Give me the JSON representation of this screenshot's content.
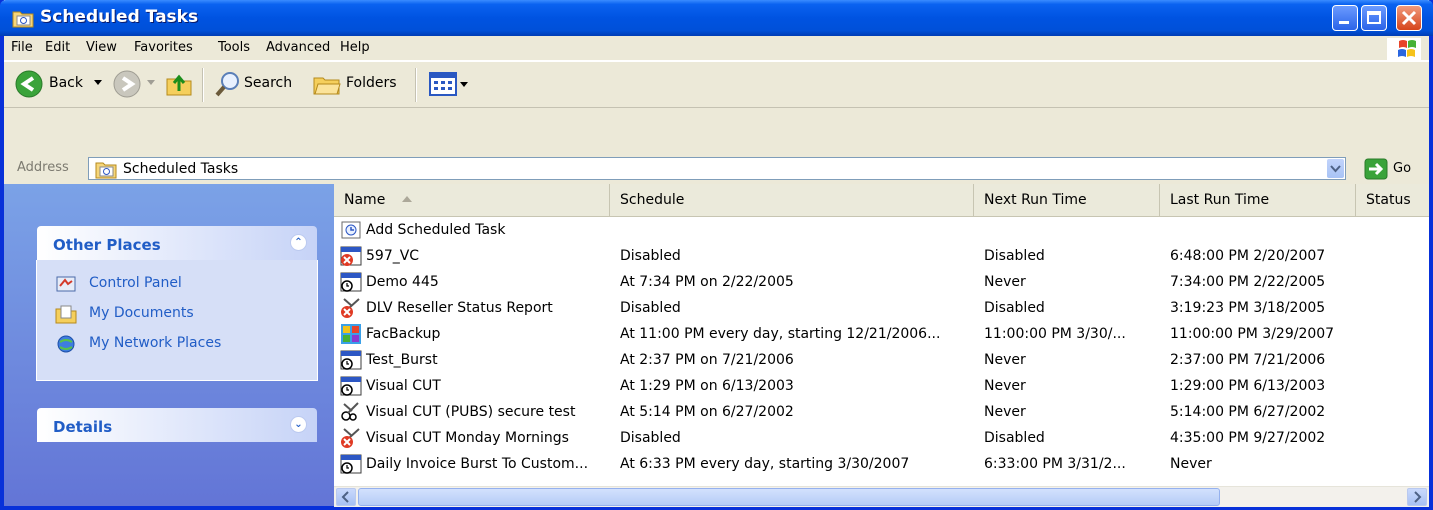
{
  "window": {
    "title": "Scheduled Tasks"
  },
  "menu": [
    {
      "label": "File",
      "ul": "F"
    },
    {
      "label": "Edit",
      "ul": "E"
    },
    {
      "label": "View",
      "ul": "V"
    },
    {
      "label": "Favorites",
      "ul": "a"
    },
    {
      "label": "Tools",
      "ul": "T"
    },
    {
      "label": "Advanced",
      "ul": "d"
    },
    {
      "label": "Help",
      "ul": "H"
    }
  ],
  "toolbar": {
    "back": "Back",
    "search": "Search",
    "folders": "Folders"
  },
  "address": {
    "label": "Address",
    "value": "Scheduled Tasks",
    "go": "Go"
  },
  "other_places": {
    "title": "Other Places",
    "items": [
      "Control Panel",
      "My Documents",
      "My Network Places"
    ]
  },
  "details": {
    "title": "Details"
  },
  "columns": [
    "Name",
    "Schedule",
    "Next Run Time",
    "Last Run Time",
    "Status"
  ],
  "rows": [
    {
      "name": "Add Scheduled Task",
      "schedule": "",
      "next": "",
      "last": "",
      "icon": "add-task-icon"
    },
    {
      "name": "597_VC",
      "schedule": "Disabled",
      "next": "Disabled",
      "last": "6:48:00 PM  2/20/2007",
      "icon": "disabled-task-icon"
    },
    {
      "name": "Demo 445",
      "schedule": "At 7:34 PM on 2/22/2005",
      "next": "Never",
      "last": "7:34:00 PM  2/22/2005",
      "icon": "task-icon"
    },
    {
      "name": "DLV Reseller Status Report",
      "schedule": "Disabled",
      "next": "Disabled",
      "last": "3:19:23 PM  3/18/2005",
      "icon": "disabled-scissors-task-icon"
    },
    {
      "name": "FacBackup",
      "schedule": "At 11:00 PM every day, starting 12/21/2006...",
      "next": "11:00:00 PM  3/30/...",
      "last": "11:00:00 PM  3/29/2007",
      "icon": "backup-task-icon"
    },
    {
      "name": "Test_Burst",
      "schedule": "At 2:37 PM on 7/21/2006",
      "next": "Never",
      "last": "2:37:00 PM  7/21/2006",
      "icon": "task-icon"
    },
    {
      "name": "Visual CUT",
      "schedule": "At 1:29 PM on 6/13/2003",
      "next": "Never",
      "last": "1:29:00 PM  6/13/2003",
      "icon": "task-icon"
    },
    {
      "name": "Visual CUT (PUBS) secure test",
      "schedule": "At 5:14 PM on 6/27/2002",
      "next": "Never",
      "last": "5:14:00 PM  6/27/2002",
      "icon": "scissors-task-icon"
    },
    {
      "name": "Visual CUT Monday Mornings",
      "schedule": "Disabled",
      "next": "Disabled",
      "last": "4:35:00 PM  9/27/2002",
      "icon": "disabled-scissors-task-icon"
    },
    {
      "name": "Daily Invoice Burst To Custom...",
      "schedule": "At 6:33 PM every day, starting 3/30/2007",
      "next": "6:33:00 PM  3/31/2...",
      "last": "Never",
      "icon": "task-icon"
    }
  ],
  "colors": {
    "titlebar": "#0053e1",
    "taskpane": "#7ba2e7",
    "link": "#215dc6",
    "chrome": "#ece9d8"
  }
}
